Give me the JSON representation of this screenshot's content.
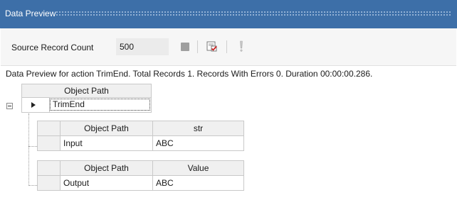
{
  "panel": {
    "title": "Data Preview"
  },
  "toolbar": {
    "source_record_count_label": "Source Record Count",
    "source_record_count_value": "500",
    "stop_icon": "stop-icon",
    "preview_icon": "preview-check-icon",
    "alert_icon": "exclamation-icon"
  },
  "status": {
    "text": "Data Preview for action TrimEnd. Total Records 1. Records With Errors 0. Duration 00:00:00.286."
  },
  "tree": {
    "header": "Object Path",
    "root_value": "TrimEnd",
    "input_grid": {
      "columns": [
        "Object Path",
        "str"
      ],
      "rows": [
        {
          "path": "Input",
          "value": "ABC"
        }
      ]
    },
    "output_grid": {
      "columns": [
        "Object Path",
        "Value"
      ],
      "rows": [
        {
          "path": "Output",
          "value": "ABC"
        }
      ]
    }
  },
  "colors": {
    "titlebar": "#3d6fa8",
    "title_text": "#ffffff",
    "check_red": "#cc2222"
  }
}
